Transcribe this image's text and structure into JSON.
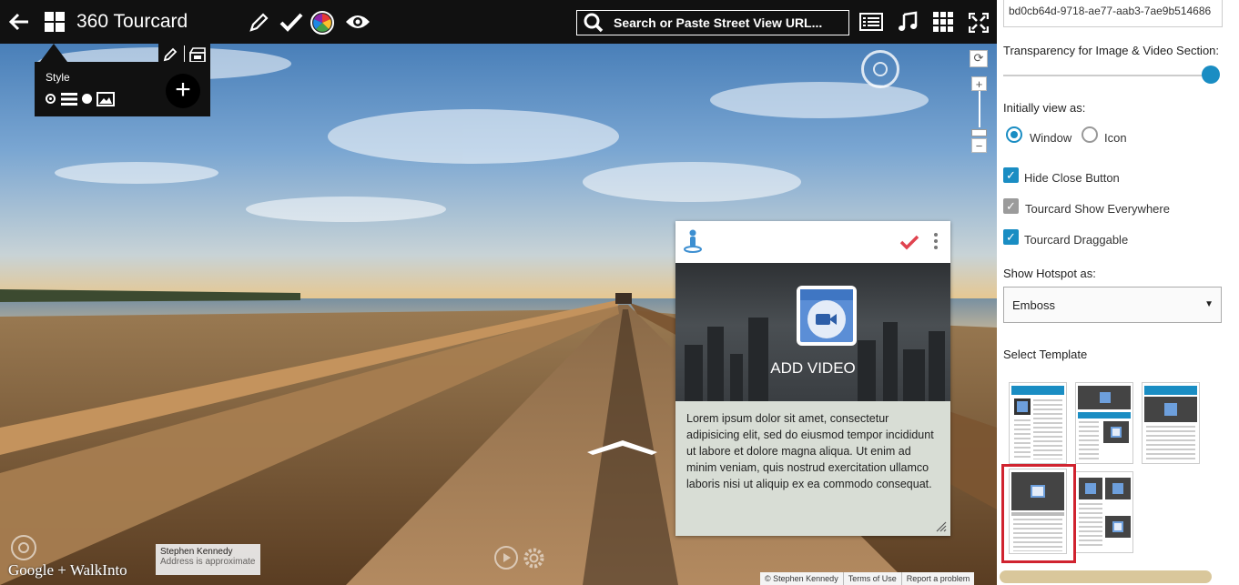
{
  "app": {
    "title": "360 Tourcard"
  },
  "toolbar": {
    "back_icon": "arrow-left-icon",
    "grid_icon": "app-grid-icon",
    "edit_icon": "pencil-icon",
    "confirm_icon": "checkmark-icon",
    "color_icon": "color-wheel-icon",
    "preview_icon": "eye-icon",
    "list_icon": "list-view-icon",
    "music_icon": "music-note-icon",
    "apps_icon": "apps-grid-icon",
    "fullscreen_icon": "fullscreen-icon"
  },
  "search": {
    "placeholder": "Search or Paste Street View URL..."
  },
  "style_panel": {
    "label": "Style",
    "add_label": "+"
  },
  "card": {
    "add_video_label": "ADD VIDEO",
    "body_text": "Lorem ipsum dolor sit amet, consectetur adipisicing elit, sed do eiusmod tempor incididunt ut labore et dolore magna aliqua. Ut enim ad minim veniam, quis nostrud exercitation ullamco laboris nisi ut aliquip ex ea commodo consequat."
  },
  "attribution": {
    "author": "Stephen Kennedy",
    "note": "Address is approximate",
    "brand": "Google + WalkInto"
  },
  "footer": {
    "copyright": "© Stephen Kennedy",
    "terms": "Terms of Use",
    "report": "Report a problem"
  },
  "panel": {
    "id_value": "bd0cb64d-9718-ae77-aab3-7ae9b514686",
    "transparency_label": "Transparency for Image & Video Section:",
    "transparency_value": 1.0,
    "initial_view_label": "Initially view as:",
    "view_options": [
      {
        "label": "Window",
        "selected": true
      },
      {
        "label": "Icon",
        "selected": false
      }
    ],
    "checkboxes": [
      {
        "label": "Hide Close Button",
        "checked": true
      },
      {
        "label": "Tourcard Show Everywhere",
        "checked": true
      },
      {
        "label": "Tourcard Draggable",
        "checked": true
      }
    ],
    "hotspot_label": "Show Hotspot as:",
    "hotspot_value": "Emboss",
    "template_label": "Select Template",
    "selected_template": 4
  },
  "colors": {
    "accent": "#1a8dc3",
    "selection": "#d0232f",
    "toolbar_bg": "#111111"
  }
}
